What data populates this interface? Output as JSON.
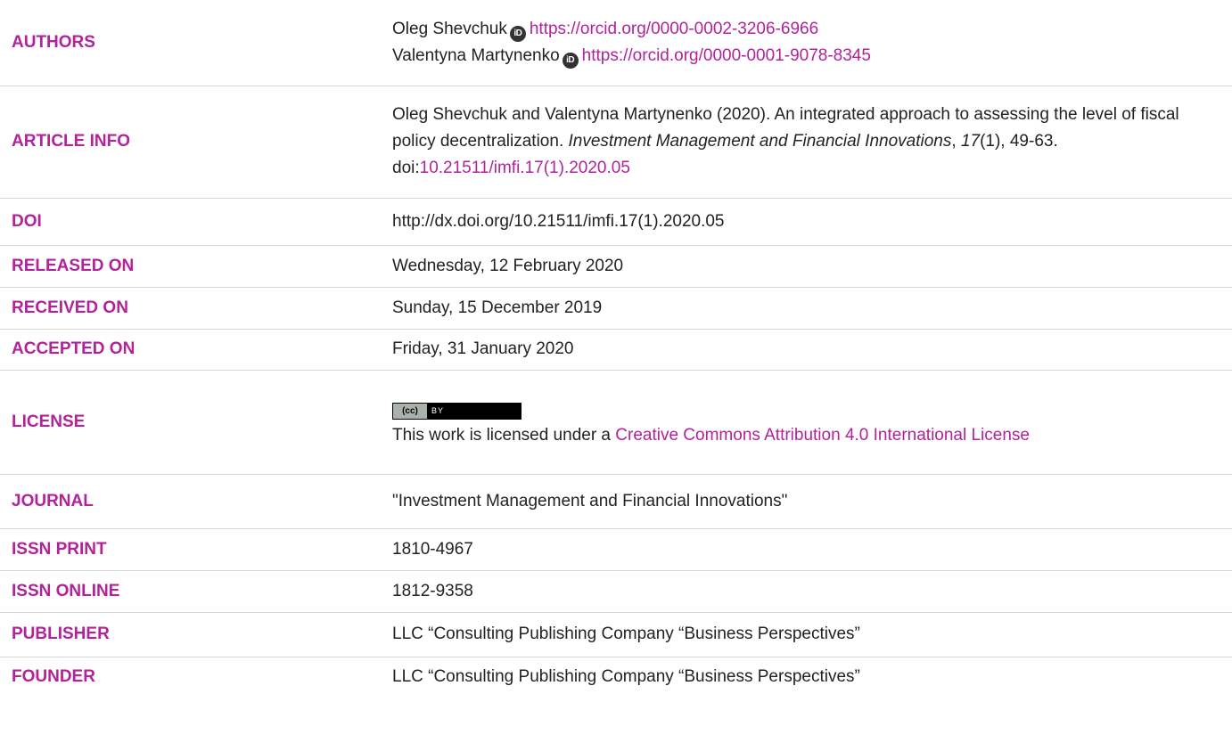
{
  "authors": {
    "label": "AUTHORS",
    "list": [
      {
        "name": "Oleg Shevchuk",
        "orcid_url": "https://orcid.org/0000-0002-3206-6966"
      },
      {
        "name": "Valentyna Martynenko",
        "orcid_url": "https://orcid.org/0000-0001-9078-8345"
      }
    ],
    "orcid_icon": "orcid-icon",
    "orcid_glyph": "iD"
  },
  "article_info": {
    "label": "ARTICLE INFO",
    "prefix": "Oleg Shevchuk and Valentyna Martynenko (2020). An integrated approach to assessing the level of fiscal policy decentralization. ",
    "journal_italic": "Investment Management and Financial Innovations",
    "sep": ", ",
    "volume_italic": "17",
    "rest": "(1), 49-63. doi:",
    "doi_link": "10.21511/imfi.17(1).2020.05"
  },
  "doi": {
    "label": "DOI",
    "value": "http://dx.doi.org/10.21511/imfi.17(1).2020.05"
  },
  "released": {
    "label": "RELEASED ON",
    "value": "Wednesday, 12 February 2020"
  },
  "received": {
    "label": "RECEIVED ON",
    "value": "Sunday, 15 December 2019"
  },
  "accepted": {
    "label": "ACCEPTED ON",
    "value": "Friday, 31 January 2020"
  },
  "license": {
    "label": "LICENSE",
    "badge_left": "(cc)",
    "badge_right": "BY",
    "text": "This work is licensed under a ",
    "link": "Creative Commons Attribution 4.0 International License"
  },
  "journal": {
    "label": "JOURNAL",
    "value": "\"Investment Management and Financial Innovations\""
  },
  "issn_print": {
    "label": "ISSN PRINT",
    "value": "1810-4967"
  },
  "issn_online": {
    "label": "ISSN ONLINE",
    "value": "1812-9358"
  },
  "publisher": {
    "label": "PUBLISHER",
    "value": "LLC “Consulting Publishing Company “Business Perspectives”"
  },
  "founder": {
    "label": "FOUNDER",
    "value": "LLC “Consulting Publishing Company “Business Perspectives”"
  },
  "colors": {
    "accent": "#b2229b",
    "text": "#222222",
    "divider": "#d9d9d9"
  }
}
